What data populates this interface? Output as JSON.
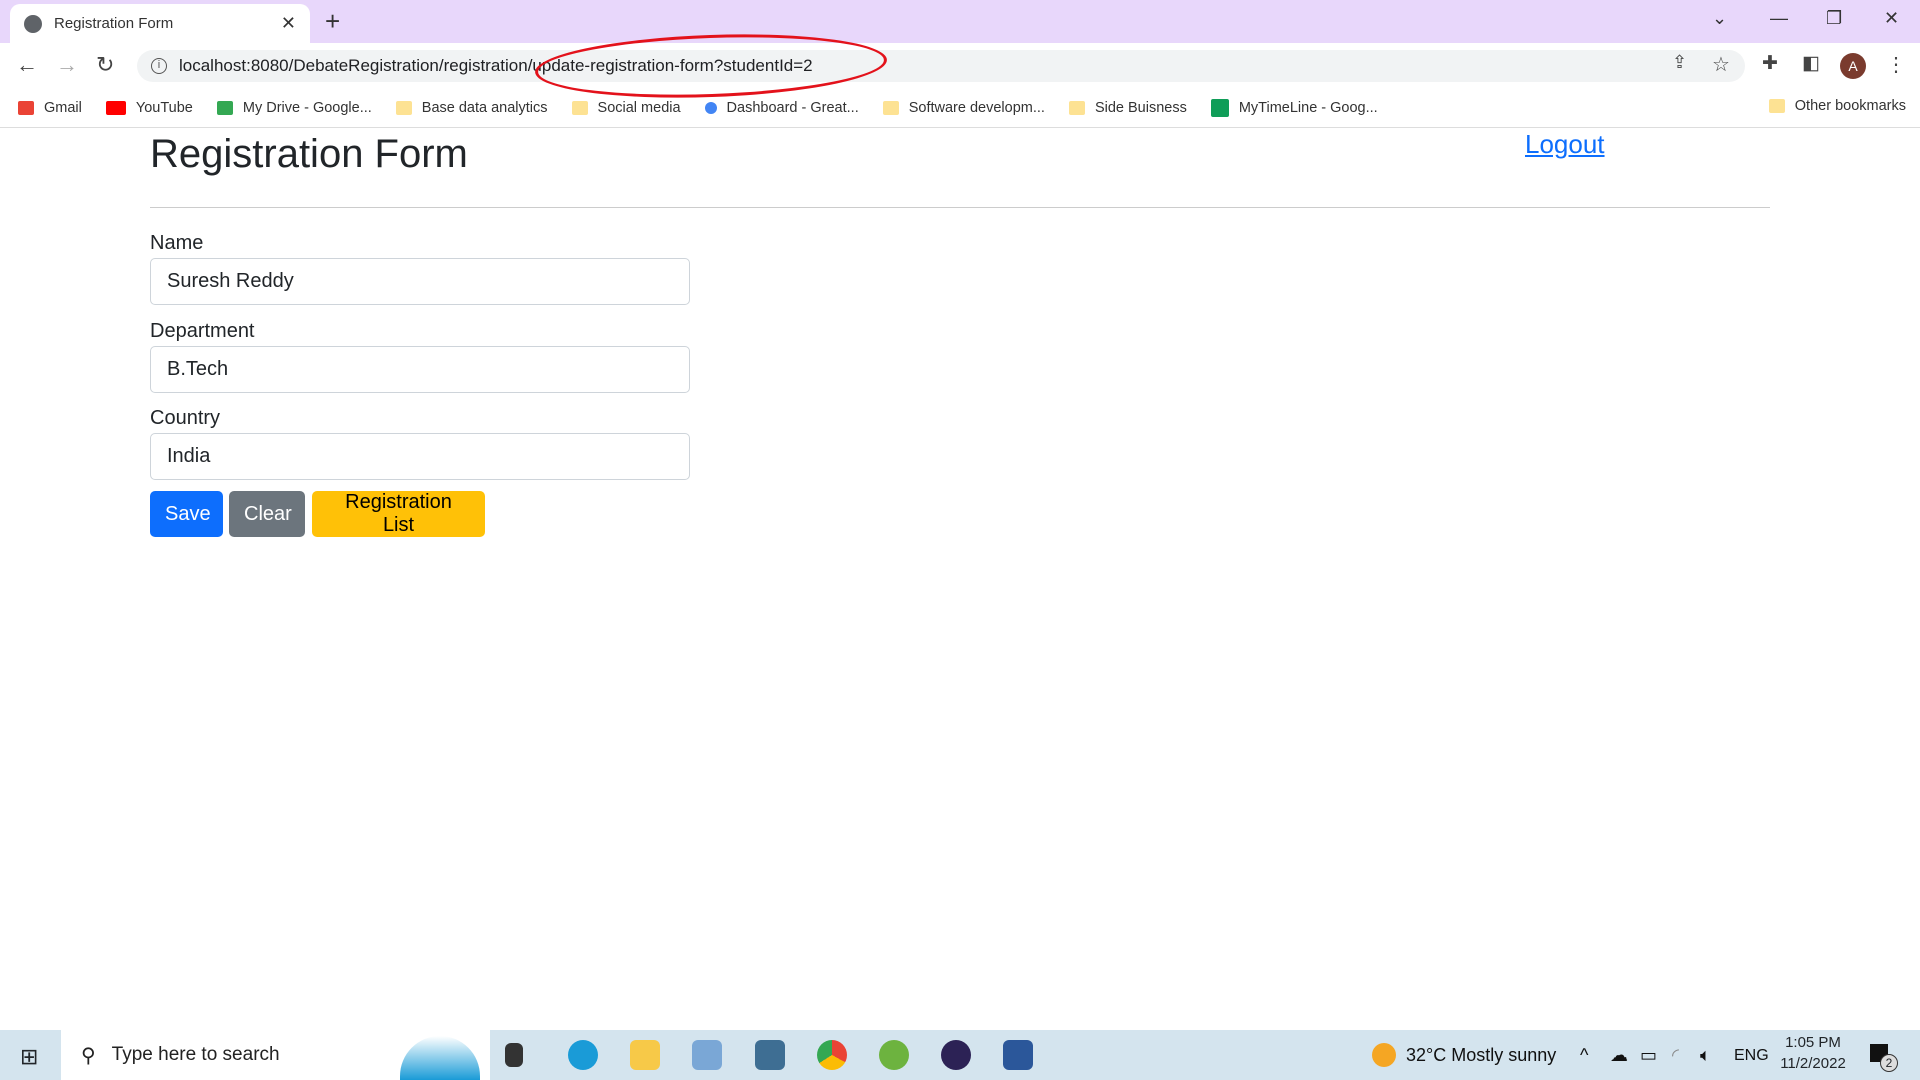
{
  "browser": {
    "tab_title": "Registration Form",
    "url": "localhost:8080/DebateRegistration/registration/update-registration-form?studentId=2",
    "bookmarks": [
      {
        "label": "Gmail",
        "color": "#ea4335"
      },
      {
        "label": "YouTube",
        "color": "#ff0000"
      },
      {
        "label": "My Drive - Google...",
        "color": "#34a853"
      },
      {
        "label": "Base data analytics",
        "color": "#fde293"
      },
      {
        "label": "Social media",
        "color": "#fde293"
      },
      {
        "label": "Dashboard - Great...",
        "color": "#4285f4"
      },
      {
        "label": "Software developm...",
        "color": "#fde293"
      },
      {
        "label": "Side Buisness",
        "color": "#fde293"
      },
      {
        "label": "MyTimeLine - Goog...",
        "color": "#0f9d58"
      }
    ],
    "other_bookmarks": "Other bookmarks",
    "profile_initial": "A",
    "annotation_color": "#e3121b"
  },
  "page": {
    "title": "Registration Form",
    "logout": "Logout",
    "fields": [
      {
        "label": "Name",
        "value": "Suresh Reddy"
      },
      {
        "label": "Department",
        "value": "B.Tech"
      },
      {
        "label": "Country",
        "value": "India"
      }
    ],
    "buttons": {
      "save": "Save",
      "clear": "Clear",
      "list": "Registration List"
    },
    "colors": {
      "save": "#0d6efd",
      "clear": "#6c757d",
      "list": "#ffc107"
    }
  },
  "taskbar": {
    "search_placeholder": "Type here to search",
    "weather": "32°C  Mostly sunny",
    "lang": "ENG",
    "time": "1:05 PM",
    "date": "11/2/2022",
    "notifications": "2"
  }
}
